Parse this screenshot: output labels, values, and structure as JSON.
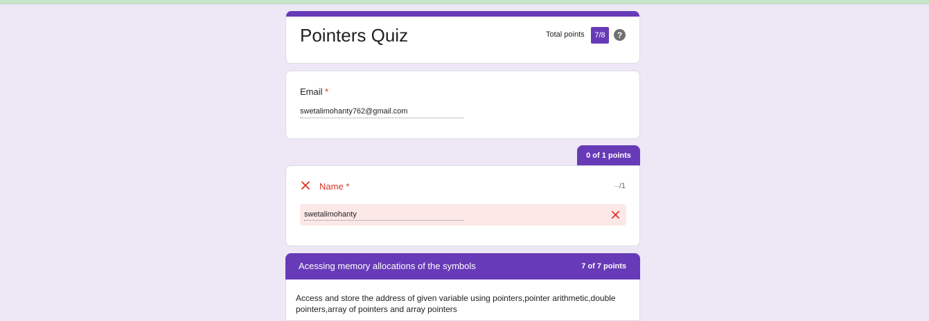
{
  "form": {
    "title": "Pointers Quiz",
    "total_points_label": "Total points",
    "total_points_value": "7/8",
    "help_symbol": "?"
  },
  "email": {
    "label": "Email",
    "required_mark": "*",
    "value": "swetalimohanty762@gmail.com"
  },
  "name_question": {
    "points_tab": "0 of 1 points",
    "label": "Name",
    "required_mark": "*",
    "score_placeholder": "···",
    "score_total": "/1",
    "answer": "swetalimohanty",
    "status_icon": "x-icon",
    "status_color": "#d93025"
  },
  "section": {
    "title": "Acessing memory allocations of the symbols",
    "points": "7 of 7 points",
    "description": "Access and store the address of given variable using pointers,pointer arithmetic,double pointers,array of pointers and array pointers"
  },
  "colors": {
    "accent": "#673ab7",
    "page_bg": "#ede7f6",
    "error": "#d93025",
    "error_bg": "#fce8e6"
  }
}
